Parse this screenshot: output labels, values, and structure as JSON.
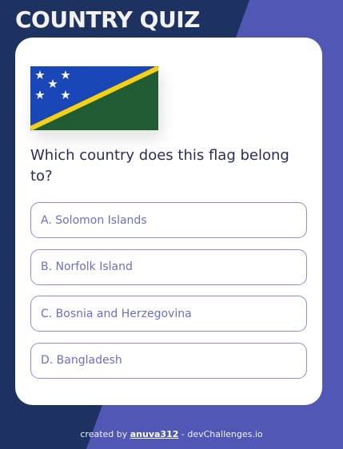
{
  "app": {
    "title": "COUNTRY QUIZ"
  },
  "quiz": {
    "flag_icon": "solomon-islands-flag",
    "question": "Which country does this flag belong to?",
    "options": [
      "A. Solomon Islands",
      "B. Norfolk Island",
      "C. Bosnia and Herzegovina",
      "D. Bangladesh"
    ]
  },
  "footer": {
    "prefix": "created by",
    "author": "anuva312",
    "suffix": "- devChallenges.io"
  },
  "colors": {
    "bg_navy": "#1d3261",
    "bg_purple": "#5157b4",
    "option_text": "#6a6fc6",
    "option_border": "#8b8fd0",
    "question_text": "#2b2d57"
  }
}
